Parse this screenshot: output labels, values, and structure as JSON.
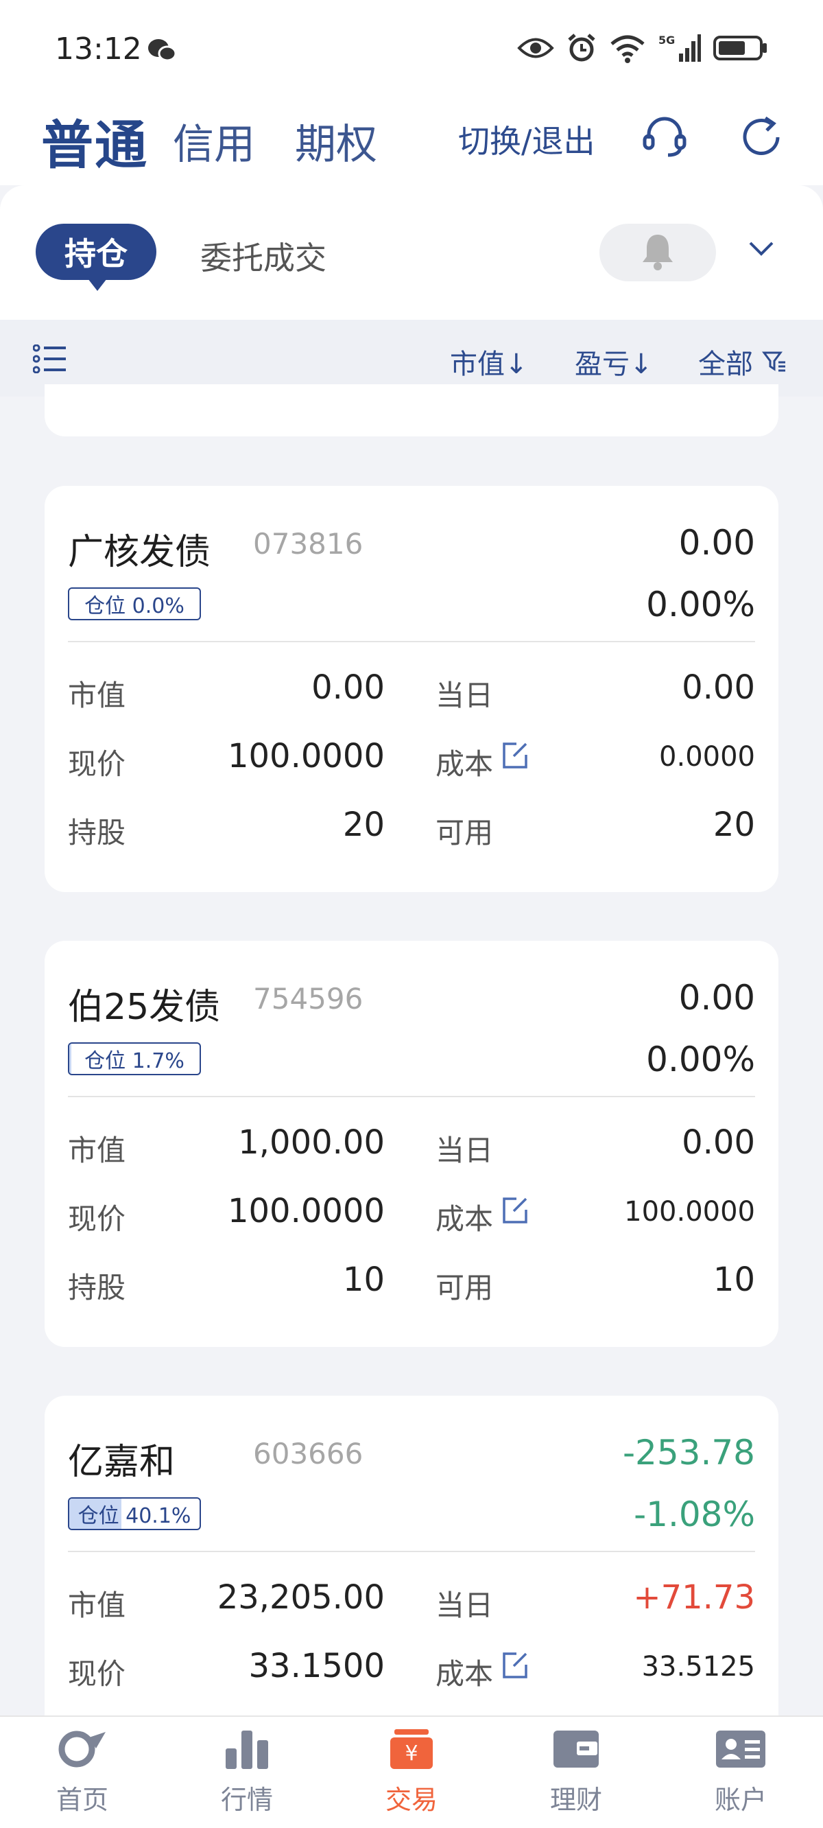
{
  "status": {
    "time": "13:12",
    "network": "5G"
  },
  "header": {
    "tabs": [
      "普通",
      "信用",
      "期权"
    ],
    "switch_label": "切换/退出"
  },
  "panel": {
    "tab_active": "持仓",
    "tab_other": "委托成交"
  },
  "sortbar": {
    "market_value": "市值↓",
    "profit": "盈亏↓",
    "all": "全部"
  },
  "labels": {
    "market_value": "市值",
    "today": "当日",
    "price": "现价",
    "cost": "成本",
    "holding": "持股",
    "available": "可用"
  },
  "positions": [
    {
      "name": "广核发债",
      "code": "073816",
      "pnl": "0.00",
      "pnl_pct": "0.00%",
      "badge": "仓位 0.0%",
      "weight": 0.0,
      "market_value": "0.00",
      "today": "0.00",
      "price": "100.0000",
      "cost": "0.0000",
      "holding": "20",
      "available": "20"
    },
    {
      "name": "伯25发债",
      "code": "754596",
      "pnl": "0.00",
      "pnl_pct": "0.00%",
      "badge": "仓位 1.7%",
      "weight": 1.7,
      "market_value": "1,000.00",
      "today": "0.00",
      "price": "100.0000",
      "cost": "100.0000",
      "holding": "10",
      "available": "10"
    },
    {
      "name": "亿嘉和",
      "code": "603666",
      "pnl": "-253.78",
      "pnl_pct": "-1.08%",
      "badge": "仓位 40.1%",
      "weight": 40.1,
      "market_value": "23,205.00",
      "today": "+71.73",
      "price": "33.1500",
      "cost": "33.5125"
    }
  ],
  "bottom_nav": [
    {
      "label": "首页",
      "icon": "home-icon"
    },
    {
      "label": "行情",
      "icon": "market-bar-icon"
    },
    {
      "label": "交易",
      "icon": "trade-yuan-icon",
      "active": true
    },
    {
      "label": "理财",
      "icon": "wallet-icon"
    },
    {
      "label": "账户",
      "icon": "account-card-icon"
    }
  ],
  "colors": {
    "brand": "#2a468b",
    "gain": "#e24a3a",
    "loss": "#3aa17b",
    "active_nav": "#f0643c"
  }
}
